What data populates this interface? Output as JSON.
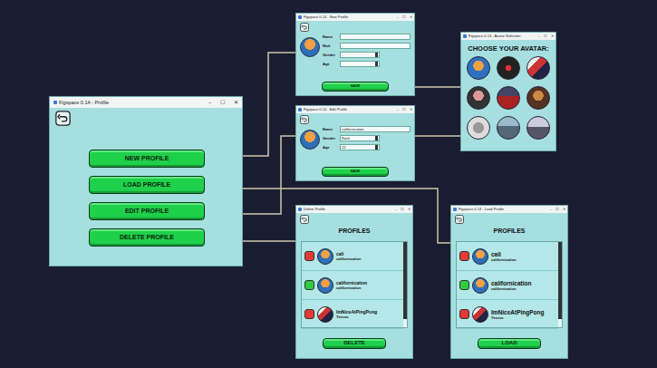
{
  "controls": [
    "–",
    "☐",
    "✕"
  ],
  "main": {
    "title": "Figspace 0.14 - Profile",
    "buttons": [
      "NEW PROFILE",
      "LOAD PROFILE",
      "EDIT PROFILE",
      "DELETE PROFILE"
    ]
  },
  "new_profile": {
    "title": "Figspace 0.14 - New Profile",
    "fields": [
      {
        "label": "Name",
        "value": "",
        "kind": "text"
      },
      {
        "label": "Nick",
        "value": "",
        "kind": "text"
      },
      {
        "label": "Gender",
        "value": "",
        "kind": "select"
      },
      {
        "label": "Age",
        "value": "",
        "kind": "select"
      }
    ],
    "button": "SAVE"
  },
  "edit_profile": {
    "title": "Figspace 0.14 - Edit Profile",
    "fields": [
      {
        "label": "Name",
        "value": "californication",
        "kind": "text"
      },
      {
        "label": "Gender",
        "value": "Rock",
        "kind": "select"
      },
      {
        "label": "Age",
        "value": "22",
        "kind": "select"
      }
    ],
    "button": "SAVE"
  },
  "avatar_selection": {
    "title": "Figspace 0.14 - Avatar Selection",
    "heading": "CHOOSE YOUR AVATAR:",
    "avatars": [
      {
        "selected": false
      },
      {
        "selected": false
      },
      {
        "selected": false
      },
      {
        "selected": false
      },
      {
        "selected": false
      },
      {
        "selected": false
      },
      {
        "selected": false
      },
      {
        "selected": false
      },
      {
        "selected": false
      }
    ]
  },
  "delete_profile": {
    "title": "Delete Profile",
    "heading": "PROFILES",
    "profiles": [
      {
        "name": "cali",
        "nick": "californication",
        "selected": false,
        "color": "#e53935"
      },
      {
        "name": "californication",
        "nick": "californication",
        "selected": true,
        "color": "#2ecc40"
      },
      {
        "name": "ImNiceAtPingPong",
        "nick": "Yeezus",
        "selected": false,
        "color": "#e53935"
      }
    ],
    "button": "DELETE"
  },
  "load_profile": {
    "title": "Figspace 0.14 - Load Profile",
    "heading": "PROFILES",
    "profiles": [
      {
        "name": "cali",
        "nick": "californication",
        "selected": false,
        "color": "#e53935"
      },
      {
        "name": "californication",
        "nick": "californication",
        "selected": true,
        "color": "#2ecc40"
      },
      {
        "name": "ImNiceAtPingPong",
        "nick": "Yeezus",
        "selected": false,
        "color": "#e53935"
      }
    ],
    "button": "LOAD"
  }
}
